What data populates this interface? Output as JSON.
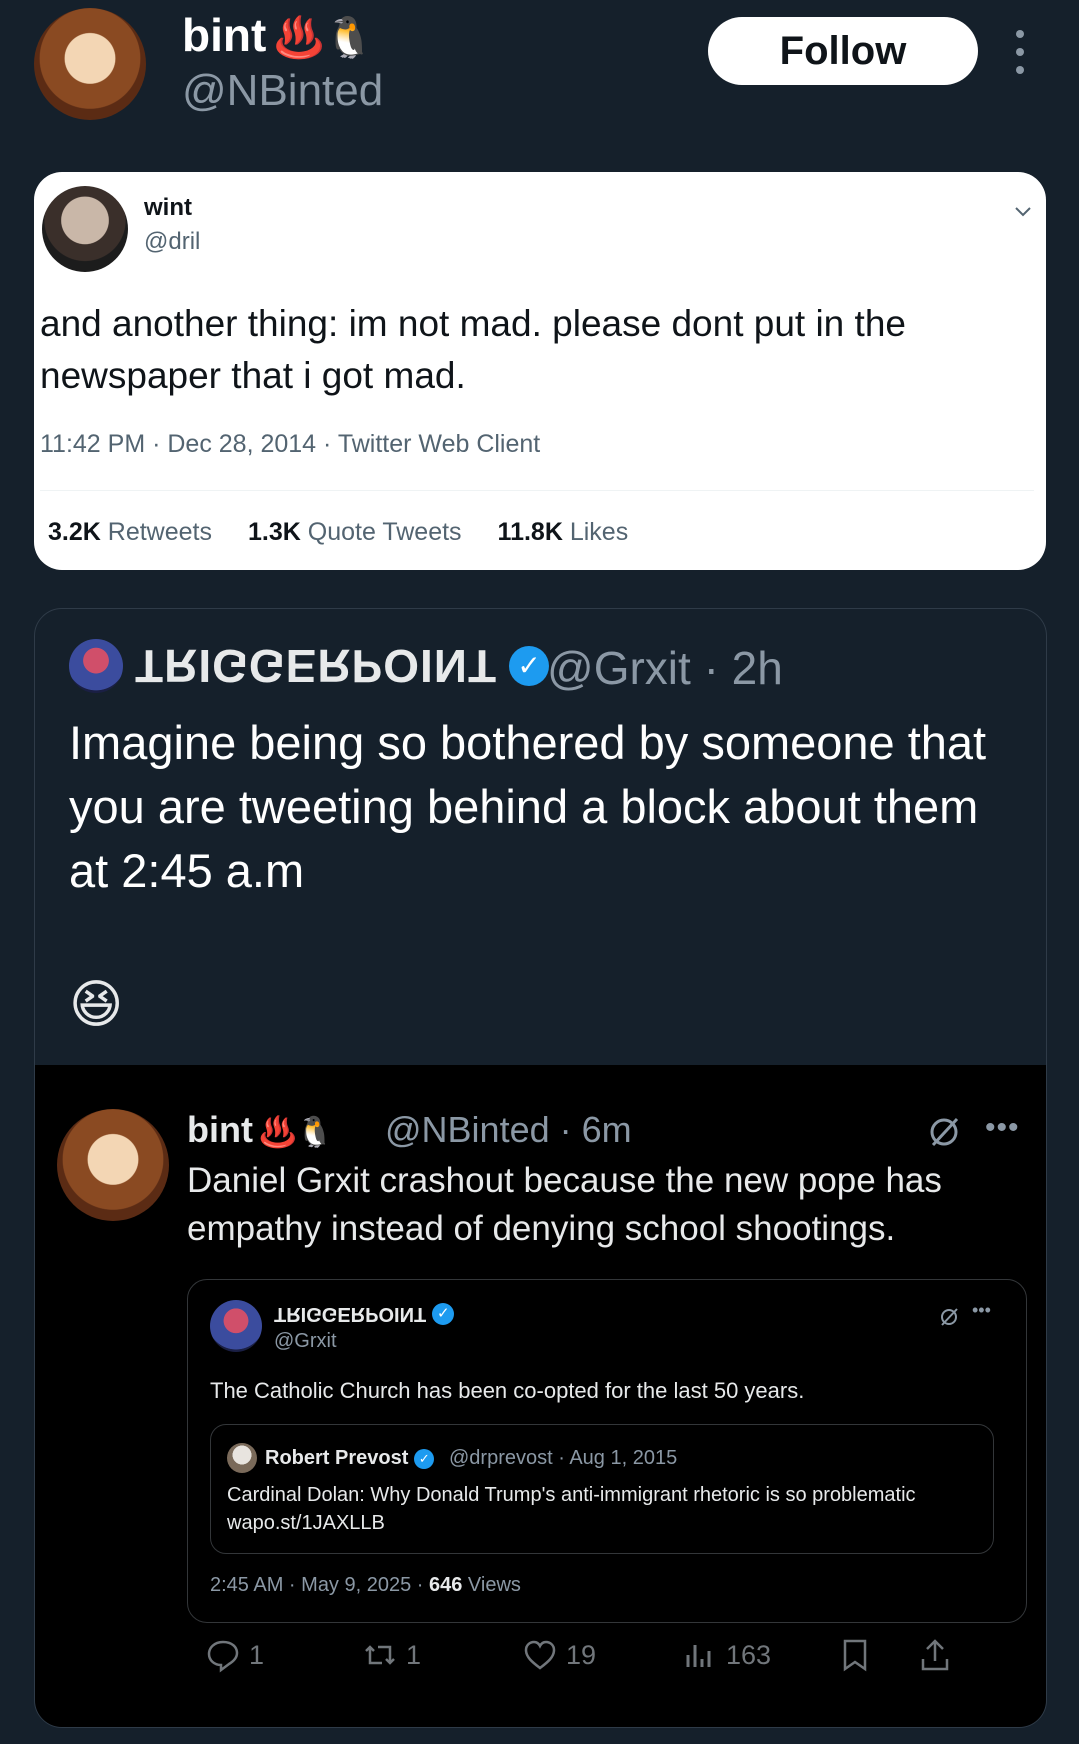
{
  "header": {
    "name": "bint",
    "name_emoji": "♨️🐧",
    "handle": "@NBinted",
    "follow_label": "Follow"
  },
  "quoted_screenshot": {
    "name": "wint",
    "handle": "@dril",
    "text": "and another thing: im not mad. please dont put in the newspaper that i got mad.",
    "meta": "11:42 PM · Dec 28, 2014 · Twitter Web Client",
    "retweets_count": "3.2K",
    "retweets_label": "Retweets",
    "quotes_count": "1.3K",
    "quotes_label": "Quote Tweets",
    "likes_count": "11.8K",
    "likes_label": "Likes"
  },
  "grxit_tweet": {
    "name": "TRIGGERPOINT",
    "handle_time": "@Grxit · 2h",
    "text": "Imagine being so bothered by someone that you are tweeting behind a block about them at 2:45 a.m",
    "emoji": "😆"
  },
  "bint_tweet": {
    "name": "bint",
    "name_emoji": "♨️🐧",
    "handle_time": "@NBinted · 6m",
    "text": "Daniel Grxit crashout because the new pope has empathy instead of denying school shootings.",
    "inner": {
      "name": "TRIGGERPOINT",
      "handle": "@Grxit",
      "text": "The Catholic Church has been co-opted for the last 50 years.",
      "nested": {
        "name": "Robert Prevost",
        "meta": "@drprevost · Aug 1, 2015",
        "text_line1": "Cardinal Dolan: Why Donald Trump's anti-immigrant rhetoric is so problematic",
        "text_line2": "wapo.st/1JAXLLB"
      },
      "meta_prefix": "2:45 AM · May 9, 2025 · ",
      "views_count": "646",
      "views_label": " Views"
    },
    "actions": {
      "replies": "1",
      "reposts": "1",
      "likes": "19",
      "views": "163"
    }
  },
  "colors": {
    "background": "#15202b",
    "black_region": "#000000",
    "verified_blue": "#1d9bf0",
    "muted_text": "#8b98a5"
  }
}
